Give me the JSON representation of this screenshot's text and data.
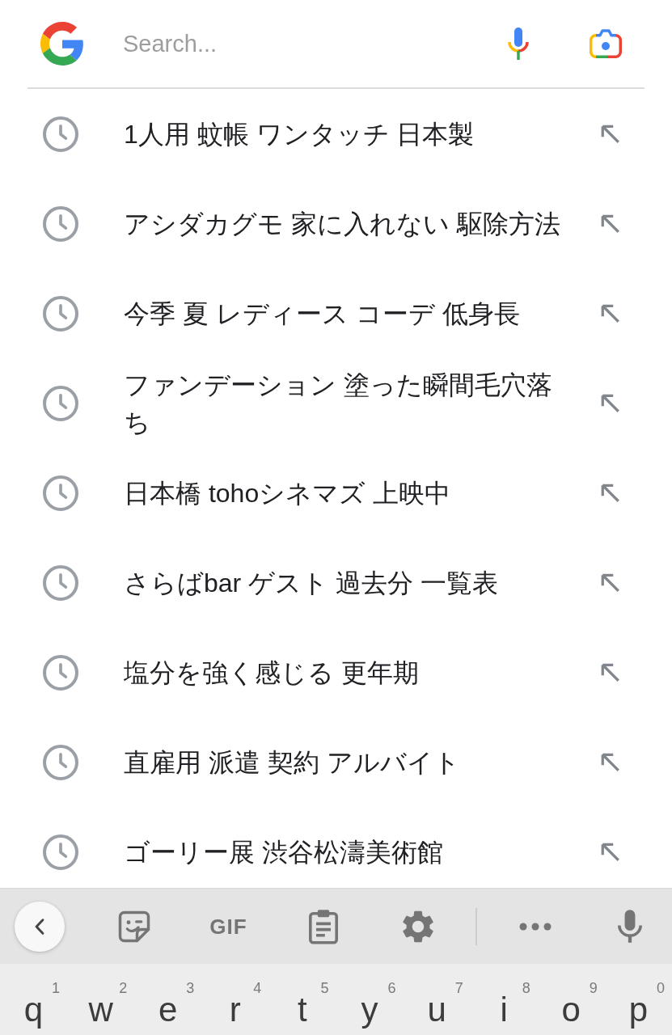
{
  "search_bar": {
    "placeholder": "Search..."
  },
  "suggestions": [
    {
      "text": "1人用 蚊帳 ワンタッチ 日本製"
    },
    {
      "text": "アシダカグモ 家に入れない 駆除方法"
    },
    {
      "text": "今季 夏 レディース コーデ 低身長"
    },
    {
      "text": "ファンデーション 塗った瞬間毛穴落ち"
    },
    {
      "text": "日本橋 tohoシネマズ 上映中"
    },
    {
      "text": "さらばbar ゲスト 過去分 一覧表"
    },
    {
      "text": "塩分を強く感じる 更年期"
    },
    {
      "text": "直雇用 派遣 契約 アルバイト"
    },
    {
      "text": "ゴーリー展 渋谷松濤美術館"
    }
  ],
  "keyboard": {
    "toolbar": {
      "gif_label": "GIF"
    },
    "keys": [
      {
        "label": "q",
        "hint": "1"
      },
      {
        "label": "w",
        "hint": "2"
      },
      {
        "label": "e",
        "hint": "3"
      },
      {
        "label": "r",
        "hint": "4"
      },
      {
        "label": "t",
        "hint": "5"
      },
      {
        "label": "y",
        "hint": "6"
      },
      {
        "label": "u",
        "hint": "7"
      },
      {
        "label": "i",
        "hint": "8"
      },
      {
        "label": "o",
        "hint": "9"
      },
      {
        "label": "p",
        "hint": "0"
      }
    ]
  }
}
